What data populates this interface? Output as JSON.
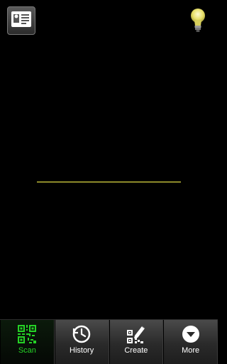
{
  "top_bar": {
    "contact_icon": "contact-card-icon",
    "flash_icon": "lightbulb-icon"
  },
  "tabs": [
    {
      "label": "Scan",
      "icon": "qr-code-icon",
      "active": true
    },
    {
      "label": "History",
      "icon": "history-clock-icon",
      "active": false
    },
    {
      "label": "Create",
      "icon": "create-qr-icon",
      "active": false
    },
    {
      "label": "More",
      "icon": "more-arrow-down-icon",
      "active": false
    }
  ],
  "colors": {
    "accent": "#25d226",
    "scan_line": "#8d8a2a",
    "background": "#000000",
    "bulb": "#e8e06a"
  }
}
